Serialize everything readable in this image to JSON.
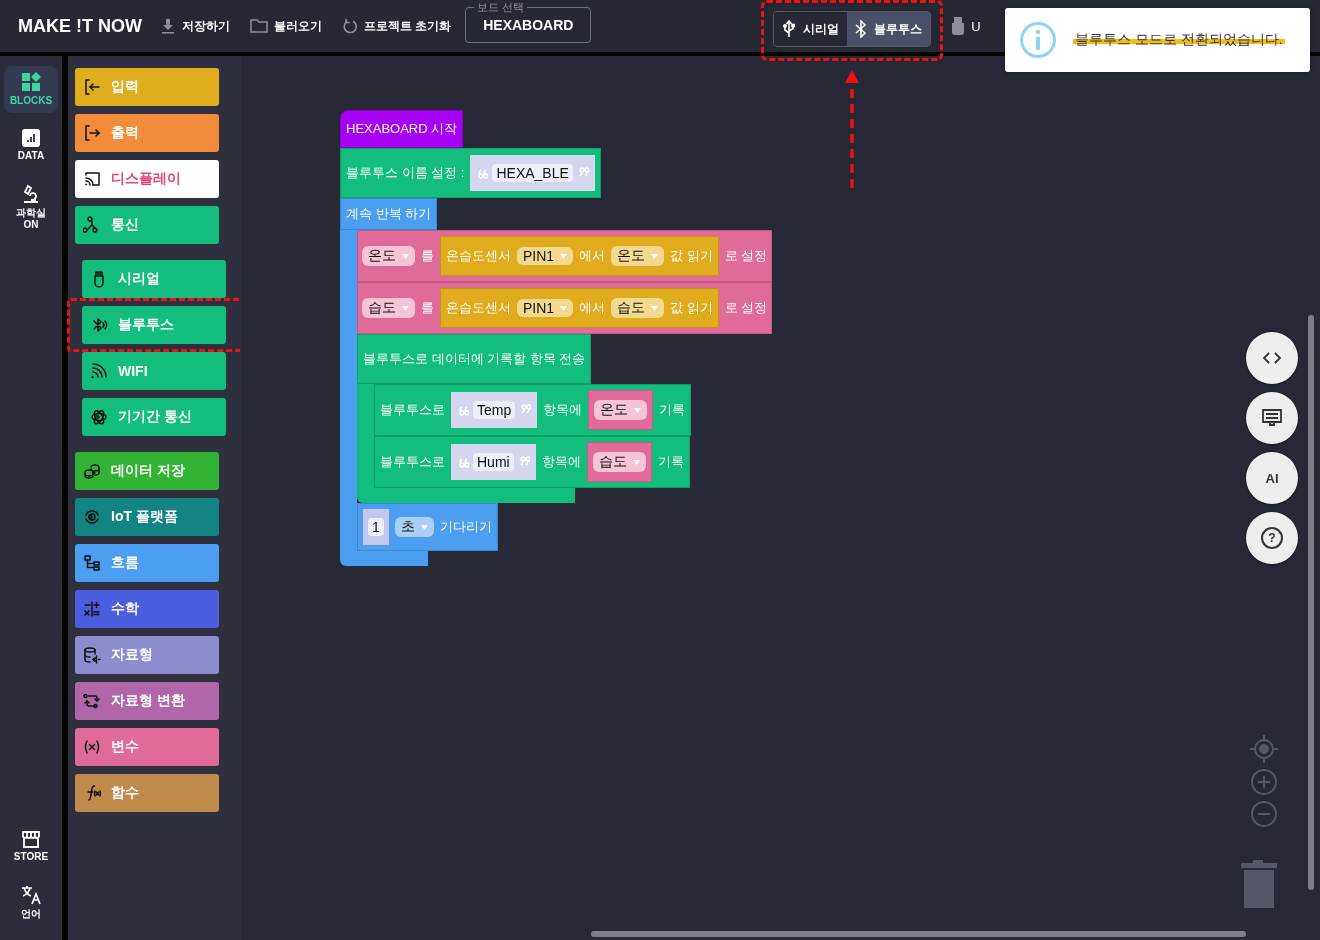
{
  "topbar": {
    "logo": "MAKE !T NOW",
    "menu": [
      {
        "label": "저장하기"
      },
      {
        "label": "불러오기"
      },
      {
        "label": "프로젝트 초기화"
      }
    ],
    "board_select": {
      "legend": "보드 선택",
      "value": "HEXABOARD"
    },
    "modes": [
      {
        "label": "시리얼",
        "selected": false
      },
      {
        "label": "블루투스",
        "selected": true
      }
    ],
    "modes_highlighted": true,
    "device": {
      "label": "U"
    }
  },
  "toast": {
    "message": "블루투스 모드로 전환되었습니다.",
    "highlighted": true
  },
  "rail": {
    "top": [
      {
        "label": "BLOCKS",
        "selected": true
      },
      {
        "label": "DATA",
        "selected": false
      },
      {
        "label": "과학실\nON",
        "selected": false
      }
    ],
    "bottom": [
      {
        "label": "STORE"
      },
      {
        "label": "언어"
      }
    ]
  },
  "categories": [
    {
      "label": "입력",
      "kind": "category",
      "color": "#e0ad1f",
      "highlighted": false
    },
    {
      "label": "출력",
      "kind": "category",
      "color": "#f28b3a",
      "highlighted": false
    },
    {
      "label": "디스플레이",
      "kind": "category",
      "color": "#ffffff",
      "highlighted": false
    },
    {
      "label": "통신",
      "kind": "category",
      "color": "#13bd7e",
      "highlighted": false
    },
    {
      "label": "시리얼",
      "kind": "subcategory",
      "color": "#13bd7e",
      "highlighted": false
    },
    {
      "label": "블루투스",
      "kind": "subcategory",
      "color": "#13bd7e",
      "highlighted": true
    },
    {
      "label": "WIFI",
      "kind": "subcategory",
      "color": "#13bd7e",
      "highlighted": false
    },
    {
      "label": "기기간 통신",
      "kind": "subcategory",
      "color": "#13bd7e",
      "highlighted": false
    },
    {
      "label": "데이터 저장",
      "kind": "category",
      "color": "#33b333",
      "highlighted": false
    },
    {
      "label": "IoT 플랫폼",
      "kind": "category",
      "color": "#128484",
      "highlighted": false
    },
    {
      "label": "흐름",
      "kind": "category",
      "color": "#4c9ef0",
      "highlighted": false
    },
    {
      "label": "수학",
      "kind": "category",
      "color": "#4c5ee0",
      "highlighted": false
    },
    {
      "label": "자료형",
      "kind": "category",
      "color": "#8c8cce",
      "highlighted": false
    },
    {
      "label": "자료형 변환",
      "kind": "category",
      "color": "#b266aa",
      "highlighted": false
    },
    {
      "label": "변수",
      "kind": "category",
      "color": "#e06b98",
      "highlighted": false
    },
    {
      "label": "함수",
      "kind": "category",
      "color": "#c08a4d",
      "highlighted": false
    }
  ],
  "workspace": {
    "blocks": [
      {
        "kind": "hat",
        "parts": [
          {
            "kind": "label",
            "text": "HEXABOARD 시작"
          }
        ]
      },
      {
        "kind": "bluetooth",
        "parts": [
          {
            "kind": "label",
            "text": "블루투스 이름 설정 :"
          },
          {
            "kind": "string",
            "text": "HEXA_BLE"
          }
        ]
      },
      {
        "kind": "loop",
        "parts": [
          {
            "kind": "label",
            "text": "계속 반복 하기"
          }
        ],
        "body": [
          {
            "kind": "variable",
            "parts": [
              {
                "kind": "dropdown",
                "text": "온도"
              },
              {
                "kind": "label",
                "text": "를"
              },
              {
                "kind": "block",
                "block": {
                  "kind": "sensor",
                  "parts": [
                    {
                      "kind": "label",
                      "text": "온습도센서"
                    },
                    {
                      "kind": "dropdown",
                      "text": "PIN1"
                    },
                    {
                      "kind": "label",
                      "text": "에서"
                    },
                    {
                      "kind": "dropdown",
                      "text": "온도"
                    },
                    {
                      "kind": "label",
                      "text": "값 읽기"
                    }
                  ]
                }
              },
              {
                "kind": "label",
                "text": "로 설정"
              }
            ]
          },
          {
            "kind": "variable",
            "parts": [
              {
                "kind": "dropdown",
                "text": "습도"
              },
              {
                "kind": "label",
                "text": "를"
              },
              {
                "kind": "block",
                "block": {
                  "kind": "sensor",
                  "parts": [
                    {
                      "kind": "label",
                      "text": "온습도센서"
                    },
                    {
                      "kind": "dropdown",
                      "text": "PIN1"
                    },
                    {
                      "kind": "label",
                      "text": "에서"
                    },
                    {
                      "kind": "dropdown",
                      "text": "습도"
                    },
                    {
                      "kind": "label",
                      "text": "값 읽기"
                    }
                  ]
                }
              },
              {
                "kind": "label",
                "text": "로 설정"
              }
            ]
          },
          {
            "kind": "bluetooth",
            "parts": [
              {
                "kind": "label",
                "text": "블루투스로 데이터에 기록할 항목 전송"
              }
            ],
            "body": [
              {
                "kind": "bluetooth",
                "parts": [
                  {
                    "kind": "label",
                    "text": "블루투스로"
                  },
                  {
                    "kind": "string",
                    "text": "Temp"
                  },
                  {
                    "kind": "label",
                    "text": "항목에"
                  },
                  {
                    "kind": "block",
                    "block": {
                      "kind": "variable",
                      "parts": [
                        {
                          "kind": "dropdown",
                          "text": "온도"
                        }
                      ]
                    }
                  },
                  {
                    "kind": "label",
                    "text": "기록"
                  }
                ]
              },
              {
                "kind": "bluetooth",
                "parts": [
                  {
                    "kind": "label",
                    "text": "블루투스로"
                  },
                  {
                    "kind": "string",
                    "text": "Humi"
                  },
                  {
                    "kind": "label",
                    "text": "항목에"
                  },
                  {
                    "kind": "block",
                    "block": {
                      "kind": "variable",
                      "parts": [
                        {
                          "kind": "dropdown",
                          "text": "습도"
                        }
                      ]
                    }
                  },
                  {
                    "kind": "label",
                    "text": "기록"
                  }
                ]
              }
            ]
          },
          {
            "kind": "loop",
            "parts": [
              {
                "kind": "number",
                "text": "1"
              },
              {
                "kind": "dropdown",
                "text": "초"
              },
              {
                "kind": "label",
                "text": "기다리기"
              }
            ]
          }
        ]
      }
    ]
  },
  "ai_button": {
    "label": "AI"
  },
  "help_button": {
    "label": "?"
  }
}
